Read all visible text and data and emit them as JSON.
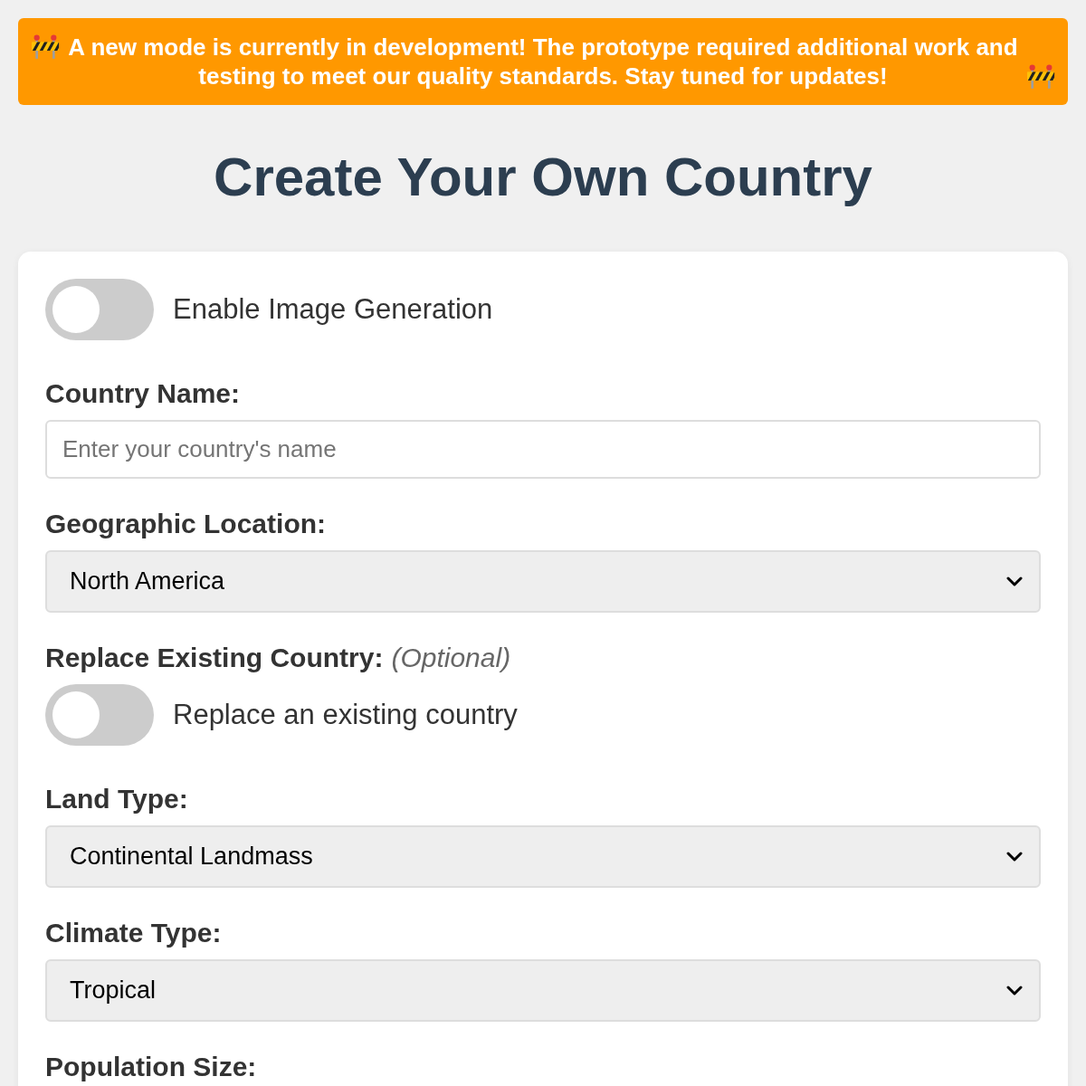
{
  "banner": {
    "text": "A new mode is currently in development! The prototype required additional work and testing to meet our quality standards. Stay tuned for updates!"
  },
  "title": "Create Your Own Country",
  "form": {
    "fields": [
      {
        "kind": "toggle",
        "toggle_label": "Enable Image Generation",
        "on": false
      },
      {
        "kind": "text",
        "label": "Country Name:",
        "placeholder": "Enter your country's name"
      },
      {
        "kind": "select",
        "label": "Geographic Location:",
        "value": "North America"
      },
      {
        "kind": "toggle",
        "label": "Replace Existing Country:",
        "note": "(Optional)",
        "toggle_label": "Replace an existing country",
        "on": false
      },
      {
        "kind": "select",
        "label": "Land Type:",
        "value": "Continental Landmass"
      },
      {
        "kind": "select",
        "label": "Climate Type:",
        "value": "Tropical"
      },
      {
        "kind": "label",
        "label": "Population Size:"
      }
    ]
  }
}
